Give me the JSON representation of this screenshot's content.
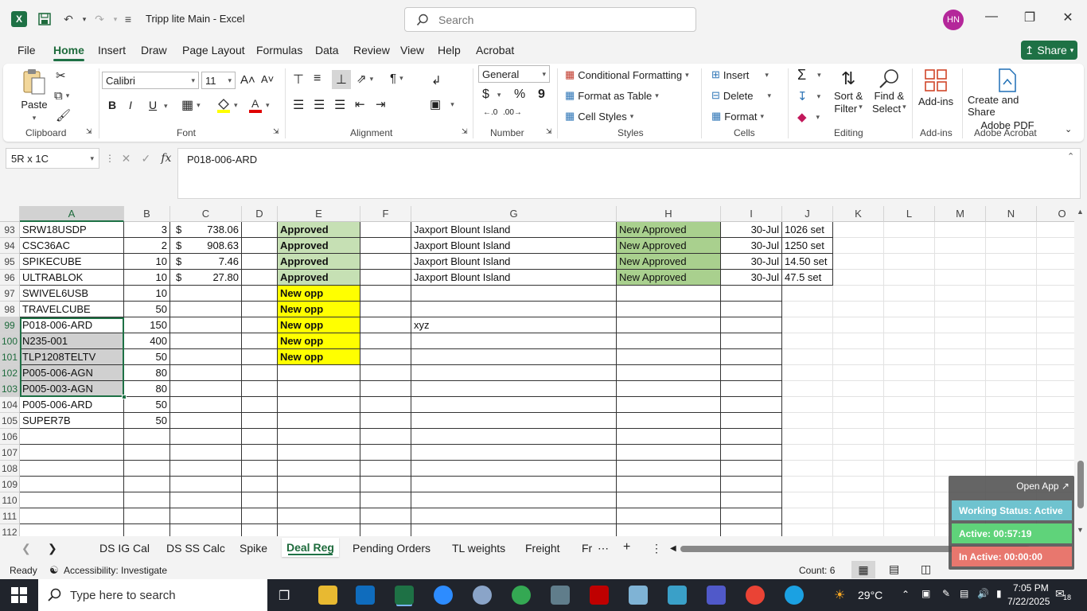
{
  "window": {
    "doc_title": "Tripp lite Main  -  Excel",
    "search_placeholder": "Search",
    "user_initials": "HN"
  },
  "menu": {
    "tabs": [
      "File",
      "Home",
      "Insert",
      "Draw",
      "Page Layout",
      "Formulas",
      "Data",
      "Review",
      "View",
      "Help",
      "Acrobat"
    ],
    "active": "Home",
    "share_label": "Share"
  },
  "ribbon": {
    "clipboard": {
      "paste": "Paste",
      "label": "Clipboard"
    },
    "font": {
      "name": "Calibri",
      "size": "11",
      "label": "Font",
      "bold": "B",
      "italic": "I",
      "underline": "U"
    },
    "alignment": {
      "label": "Alignment"
    },
    "number": {
      "format": "General",
      "label": "Number",
      "currency": "$",
      "percent": "%",
      "comma": "9"
    },
    "styles": {
      "conditional": "Conditional Formatting",
      "table": "Format as Table",
      "cell_styles": "Cell Styles",
      "label": "Styles"
    },
    "cells": {
      "insert": "Insert",
      "delete": "Delete",
      "format": "Format",
      "label": "Cells"
    },
    "editing": {
      "sort": "Sort &",
      "filter": "Filter",
      "find": "Find &",
      "select": "Select",
      "label": "Editing"
    },
    "addins": {
      "addins": "Add-ins",
      "label": "Add-ins"
    },
    "acrobat": {
      "create": "Create and Share",
      "pdf": "Adobe PDF",
      "label": "Adobe Acrobat"
    }
  },
  "formula_bar": {
    "name_box": "5R x 1C",
    "formula": "P018-006-ARD"
  },
  "grid": {
    "columns": [
      "A",
      "B",
      "C",
      "D",
      "E",
      "F",
      "G",
      "H",
      "I",
      "J",
      "K",
      "L",
      "M",
      "N",
      "O"
    ],
    "rows": [
      {
        "n": "93",
        "A": "SRW18USDP",
        "B": "3",
        "C": "738.06",
        "E": "Approved",
        "G": "Jaxport Blount Island",
        "H": "New Approved",
        "I": "30-Jul",
        "J": "1026 set"
      },
      {
        "n": "94",
        "A": "CSC36AC",
        "B": "2",
        "C": "908.63",
        "E": "Approved",
        "G": "Jaxport Blount Island",
        "H": "New Approved",
        "I": "30-Jul",
        "J": "1250 set"
      },
      {
        "n": "95",
        "A": "SPIKECUBE",
        "B": "10",
        "C": "7.46",
        "E": "Approved",
        "G": "Jaxport Blount Island",
        "H": "New Approved",
        "I": "30-Jul",
        "J": "14.50 set"
      },
      {
        "n": "96",
        "A": "ULTRABLOK",
        "B": "10",
        "C": "27.80",
        "E": "Approved",
        "G": "Jaxport Blount Island",
        "H": "New Approved",
        "I": "30-Jul",
        "J": "47.5  set"
      },
      {
        "n": "97",
        "A": "SWIVEL6USB",
        "B": "10",
        "E": "New opp"
      },
      {
        "n": "98",
        "A": "TRAVELCUBE",
        "B": "50",
        "E": "New opp"
      },
      {
        "n": "99",
        "A": "P018-006-ARD",
        "B": "150",
        "E": "New opp",
        "G": "xyz"
      },
      {
        "n": "100",
        "A": "N235-001",
        "B": "400",
        "E": "New opp"
      },
      {
        "n": "101",
        "A": "TLP1208TELTV",
        "B": "50",
        "E": "New opp"
      },
      {
        "n": "102",
        "A": "P005-006-AGN",
        "B": "80"
      },
      {
        "n": "103",
        "A": "P005-003-AGN",
        "B": "80"
      },
      {
        "n": "104",
        "A": "P005-006-ARD",
        "B": "50"
      },
      {
        "n": "105",
        "A": "SUPER7B",
        "B": "50"
      },
      {
        "n": "106"
      },
      {
        "n": "107"
      },
      {
        "n": "108"
      },
      {
        "n": "109"
      },
      {
        "n": "110"
      },
      {
        "n": "111"
      },
      {
        "n": "112"
      }
    ],
    "currency_symbol": "$"
  },
  "sheets": {
    "tabs": [
      "DS IG Cal",
      "DS SS Calc",
      "Spike",
      "Deal Reg",
      "Pending Orders",
      "TL weights",
      "Freight",
      "Fr"
    ],
    "active": "Deal Reg"
  },
  "status": {
    "ready": "Ready",
    "accessibility": "Accessibility: Investigate",
    "count": "Count: 6"
  },
  "widget": {
    "open_app": "Open App ↗",
    "working": "Working Status: Active",
    "active": "Active: 00:57:19",
    "inactive": "In Active: 00:00:00",
    "colors": {
      "working": "#6fc3cf",
      "active": "#5fd37a",
      "inactive": "#e8776e"
    }
  },
  "taskbar": {
    "search_placeholder": "Type here to search",
    "temperature": "29°C",
    "time": "7:05 PM",
    "date": "7/22/2025",
    "notifications": "18"
  }
}
